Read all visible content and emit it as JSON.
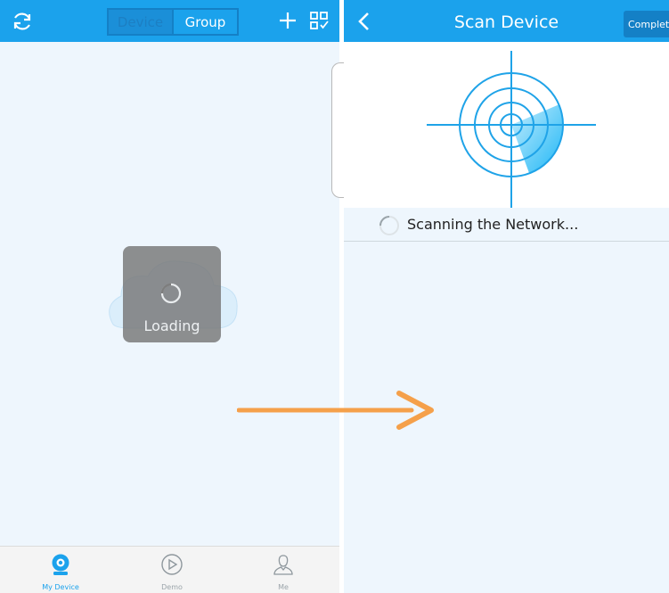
{
  "left_screen": {
    "header": {
      "refresh_icon": "refresh-icon",
      "tabs": [
        {
          "label": "Device",
          "active": true
        },
        {
          "label": "Group",
          "active": false
        }
      ],
      "add_icon": "plus-icon",
      "qr_icon": "qr-scan-icon"
    },
    "loading": {
      "text": "Loading"
    },
    "bottom_nav": [
      {
        "label": "My Device",
        "icon": "camera-icon",
        "active": true
      },
      {
        "label": "Demo",
        "icon": "play-icon",
        "active": false
      },
      {
        "label": "Me",
        "icon": "user-icon",
        "active": false
      }
    ]
  },
  "right_screen": {
    "header": {
      "back_icon": "chevron-left-icon",
      "title": "Scan Device",
      "complete_label": "Complete"
    },
    "status": {
      "text": "Scanning the Network..."
    }
  },
  "colors": {
    "header_blue": "#1ba2ec",
    "background": "#eef6fd",
    "radar_blue": "#1fa3e8",
    "arrow_orange": "#f5a04a"
  }
}
